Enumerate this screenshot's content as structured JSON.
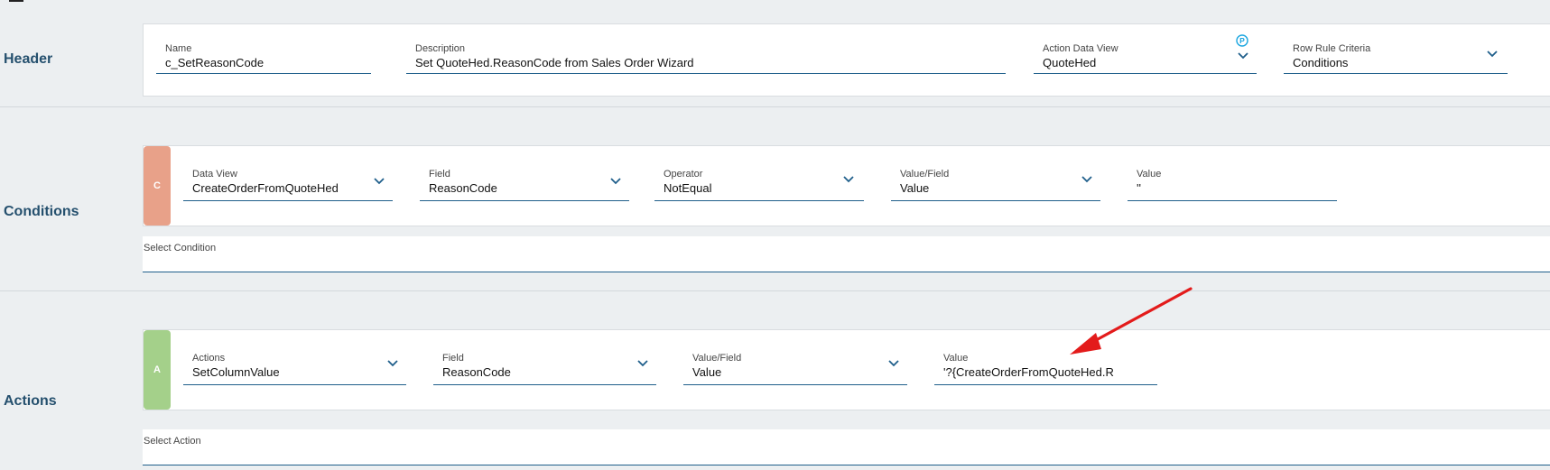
{
  "header": {
    "label": "Header",
    "name": {
      "label": "Name",
      "value": "c_SetReasonCode"
    },
    "description": {
      "label": "Description",
      "value": "Set QuoteHed.ReasonCode from Sales Order Wizard"
    },
    "action_data_view": {
      "label": "Action Data View",
      "value": "QuoteHed",
      "badge": "P"
    },
    "row_rule_criteria": {
      "label": "Row Rule Criteria",
      "value": "Conditions"
    }
  },
  "conditions": {
    "label": "Conditions",
    "tag": "C",
    "tag_color": "#e8a189",
    "data_view": {
      "label": "Data View",
      "value": "CreateOrderFromQuoteHed"
    },
    "field": {
      "label": "Field",
      "value": "ReasonCode"
    },
    "operator": {
      "label": "Operator",
      "value": "NotEqual"
    },
    "value_field": {
      "label": "Value/Field",
      "value": "Value"
    },
    "value": {
      "label": "Value",
      "value": "''"
    },
    "select_label": "Select Condition"
  },
  "actions": {
    "label": "Actions",
    "tag": "A",
    "tag_color": "#a4d08a",
    "action": {
      "label": "Actions",
      "value": "SetColumnValue"
    },
    "field": {
      "label": "Field",
      "value": "ReasonCode"
    },
    "value_field": {
      "label": "Value/Field",
      "value": "Value"
    },
    "value": {
      "label": "Value",
      "value": "'?{CreateOrderFromQuoteHed.R"
    },
    "select_label": "Select Action"
  },
  "colors": {
    "accent": "#1f5f8b",
    "section_label": "#25506e",
    "annotation_arrow": "#e31b1b",
    "badge": "#1aa6e0"
  }
}
